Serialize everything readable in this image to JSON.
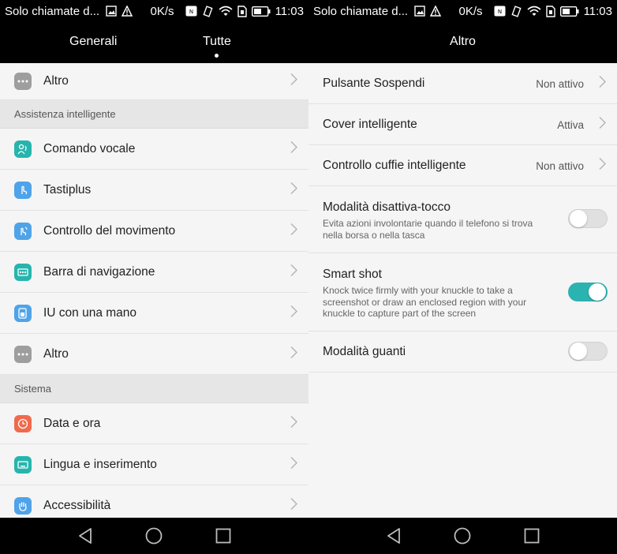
{
  "statusbar": {
    "carrier": "Solo chiamate d...",
    "rate": "0K/s",
    "time": "11:03",
    "icons": [
      "image-icon",
      "warning-icon",
      "nfc-icon",
      "vibrate-icon",
      "wifi-icon",
      "sim-icon",
      "battery-icon"
    ]
  },
  "left": {
    "tabs": [
      {
        "label": "Generali"
      },
      {
        "label": "Tutte"
      }
    ],
    "top_item": {
      "label": "Altro",
      "icon": "more-icon",
      "color": "#9e9e9e"
    },
    "section1": "Assistenza intelligente",
    "items1": [
      {
        "label": "Comando vocale",
        "icon": "voice-command-icon",
        "color": "#26b5ad"
      },
      {
        "label": "Tastiplus",
        "icon": "touch-icon",
        "color": "#4fa3e8"
      },
      {
        "label": "Controllo del movimento",
        "icon": "motion-icon",
        "color": "#4fa3e8"
      },
      {
        "label": "Barra di navigazione",
        "icon": "navigation-bar-icon",
        "color": "#26b5ad"
      },
      {
        "label": "IU con una mano",
        "icon": "one-hand-icon",
        "color": "#4fa3e8"
      },
      {
        "label": "Altro",
        "icon": "more-icon",
        "color": "#9e9e9e"
      }
    ],
    "section2": "Sistema",
    "items2": [
      {
        "label": "Data e ora",
        "icon": "clock-icon",
        "color": "#f06a4e"
      },
      {
        "label": "Lingua e inserimento",
        "icon": "keyboard-icon",
        "color": "#26b5ad"
      },
      {
        "label": "Accessibilità",
        "icon": "hand-icon",
        "color": "#4fa3e8"
      }
    ]
  },
  "right": {
    "title": "Altro",
    "rows": [
      {
        "label": "Pulsante Sospendi",
        "value": "Non attivo"
      },
      {
        "label": "Cover intelligente",
        "value": "Attiva"
      },
      {
        "label": "Controllo cuffie intelligente",
        "value": "Non attivo"
      }
    ],
    "toggles": [
      {
        "label": "Modalità disattiva-tocco",
        "desc": "Evita azioni involontarie quando il telefono si trova nella borsa o nella tasca",
        "on": false
      },
      {
        "label": "Smart shot",
        "desc": "Knock twice firmly with your knuckle to take a screenshot or draw an enclosed region with your knuckle to capture part of the screen",
        "on": true
      },
      {
        "label": "Modalità guanti",
        "desc": "",
        "on": false
      }
    ]
  },
  "colors": {
    "accent": "#2bb3b1",
    "bar": "#000000",
    "background": "#f5f5f5"
  }
}
